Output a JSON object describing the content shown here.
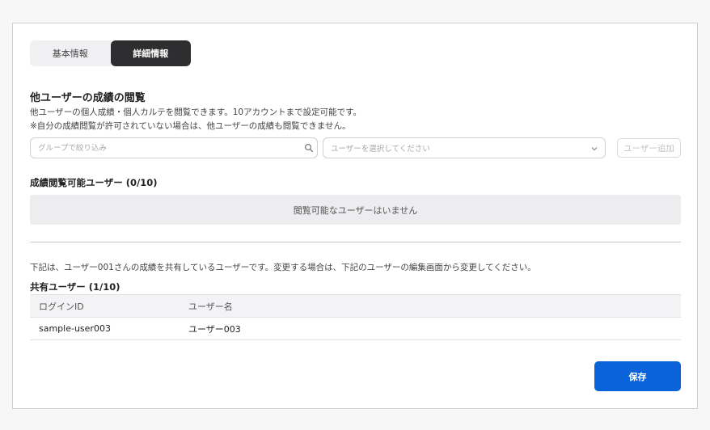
{
  "tabs": [
    {
      "label": "基本情報",
      "active": false
    },
    {
      "label": "詳細情報",
      "active": true
    }
  ],
  "section": {
    "title": "他ユーザーの成績の閲覧",
    "description_1": "他ユーザーの個人成績・個人カルテを閲覧できます。10アカウントまで設定可能です。",
    "description_2": "※自分の成績閲覧が許可されていない場合は、他ユーザーの成績も閲覧できません。"
  },
  "filter": {
    "placeholder": "グループで絞り込み",
    "icon": "search-icon"
  },
  "user_select": {
    "placeholder": "ユーザーを選択してください",
    "icon": "chevron-down-icon"
  },
  "add_button": {
    "label": "ユーザー追加",
    "disabled": true
  },
  "viewable": {
    "title": "成績閲覧可能ユーザー (0/10)",
    "empty_text": "閲覧可能なユーザーはいません"
  },
  "shared": {
    "note": "下記は、ユーザー001さんの成績を共有しているユーザーです。変更する場合は、下記のユーザーの編集画面から変更してください。",
    "title": "共有ユーザー (1/10)",
    "columns": [
      "ログインID",
      "ユーザー名"
    ],
    "rows": [
      {
        "login_id": "sample-user003",
        "user_name": "ユーザー003"
      }
    ]
  },
  "save_button": {
    "label": "保存"
  },
  "colors": {
    "primary": "#0a63d8",
    "tab_active": "#2e2e30",
    "empty_bg": "#ededf0"
  }
}
